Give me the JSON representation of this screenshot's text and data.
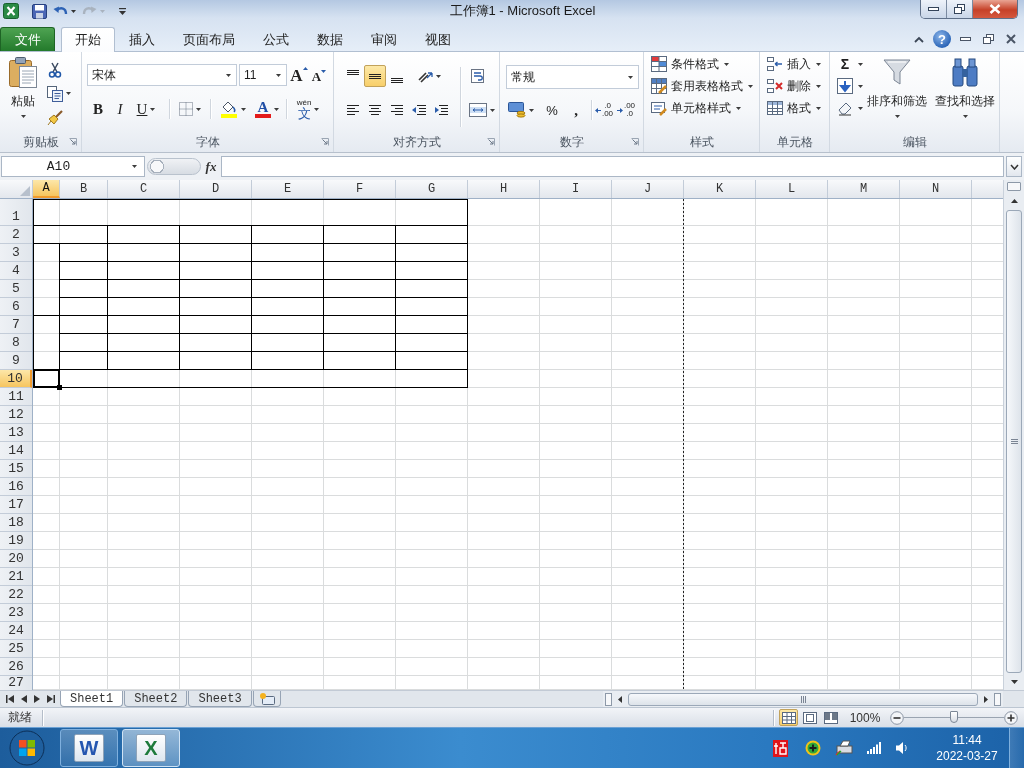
{
  "title_bar": {
    "title": "工作簿1 - Microsoft Excel",
    "undo": {
      "disabled": false
    },
    "redo": {
      "disabled": true
    }
  },
  "file_tab": {
    "label": "文件"
  },
  "tabs": [
    {
      "label": "开始",
      "selected": true
    },
    {
      "label": "插入",
      "selected": false
    },
    {
      "label": "页面布局",
      "selected": false
    },
    {
      "label": "公式",
      "selected": false
    },
    {
      "label": "数据",
      "selected": false
    },
    {
      "label": "审阅",
      "selected": false
    },
    {
      "label": "视图",
      "selected": false
    }
  ],
  "help": {
    "label": "?"
  },
  "ribbon": {
    "clipboard": {
      "label": "剪贴板",
      "paste": "粘贴"
    },
    "font": {
      "label": "字体",
      "font_name": "宋体",
      "font_size": "11",
      "grow": "A",
      "shrink": "A",
      "styles": [
        "B",
        "I",
        "U"
      ],
      "font_color": "A",
      "phonetic": {
        "ruby": "wén",
        "char": "文"
      }
    },
    "alignment": {
      "label": "对齐方式",
      "vertical": [
        {
          "selected": false
        },
        {
          "selected": true
        },
        {
          "selected": false
        }
      ],
      "horizontal": [
        {
          "selected": false
        },
        {
          "selected": false
        },
        {
          "selected": false
        }
      ]
    },
    "number": {
      "label": "数字",
      "format": "常规",
      "percent": "%",
      "comma": ",",
      "decimals": [
        {
          "top": ".0",
          "bottom": ".00"
        },
        {
          "top": ".00",
          "bottom": ".0"
        }
      ]
    },
    "styles": {
      "label": "样式",
      "items": [
        "条件格式",
        "套用表格格式",
        "单元格样式"
      ]
    },
    "cells": {
      "label": "单元格",
      "items": [
        "插入",
        "删除",
        "格式"
      ]
    },
    "editing": {
      "label": "编辑",
      "sum": "Σ",
      "items": [
        "排序和筛选",
        "查找和选择"
      ]
    }
  },
  "formula_bar": {
    "name_box": "A10",
    "function": "fx"
  },
  "sheet": {
    "columns": [
      {
        "label": "A",
        "selected": true
      },
      {
        "label": "B",
        "selected": false
      },
      {
        "label": "C",
        "selected": false
      },
      {
        "label": "D",
        "selected": false
      },
      {
        "label": "E",
        "selected": false
      },
      {
        "label": "F",
        "selected": false
      },
      {
        "label": "G",
        "selected": false
      },
      {
        "label": "H",
        "selected": false
      },
      {
        "label": "I",
        "selected": false
      },
      {
        "label": "J",
        "selected": false
      },
      {
        "label": "K",
        "selected": false
      },
      {
        "label": "L",
        "selected": false
      },
      {
        "label": "M",
        "selected": false
      },
      {
        "label": "N",
        "selected": false
      }
    ],
    "rows": [
      {
        "label": "1",
        "selected": false
      },
      {
        "label": "2",
        "selected": false
      },
      {
        "label": "3",
        "selected": false
      },
      {
        "label": "4",
        "selected": false
      },
      {
        "label": "5",
        "selected": false
      },
      {
        "label": "6",
        "selected": false
      },
      {
        "label": "7",
        "selected": false
      },
      {
        "label": "8",
        "selected": false
      },
      {
        "label": "9",
        "selected": false
      },
      {
        "label": "10",
        "selected": true
      },
      {
        "label": "11",
        "selected": false
      },
      {
        "label": "12",
        "selected": false
      },
      {
        "label": "13",
        "selected": false
      },
      {
        "label": "14",
        "selected": false
      },
      {
        "label": "15",
        "selected": false
      },
      {
        "label": "16",
        "selected": false
      },
      {
        "label": "17",
        "selected": false
      },
      {
        "label": "18",
        "selected": false
      },
      {
        "label": "19",
        "selected": false
      },
      {
        "label": "20",
        "selected": false
      },
      {
        "label": "21",
        "selected": false
      },
      {
        "label": "22",
        "selected": false
      },
      {
        "label": "23",
        "selected": false
      },
      {
        "label": "24",
        "selected": false
      },
      {
        "label": "25",
        "selected": false
      },
      {
        "label": "26",
        "selected": false
      },
      {
        "label": "27",
        "selected": false
      }
    ]
  },
  "sheet_tabs": [
    {
      "label": "Sheet1",
      "selected": true
    },
    {
      "label": "Sheet2",
      "selected": false
    },
    {
      "label": "Sheet3",
      "selected": false
    }
  ],
  "status_bar": {
    "status": "就绪",
    "views": [
      {
        "selected": true
      },
      {
        "selected": false
      },
      {
        "selected": false
      }
    ],
    "zoom": "100%",
    "zoom_slider": {
      "level": 0.5
    }
  },
  "taskbar": {
    "apps": [
      {
        "glyph": "W",
        "color": "#2456b0",
        "selected": false
      },
      {
        "glyph": "X",
        "color": "#1e7b3c",
        "selected": true
      }
    ],
    "time": "11:44",
    "date": "2022-03-27"
  }
}
